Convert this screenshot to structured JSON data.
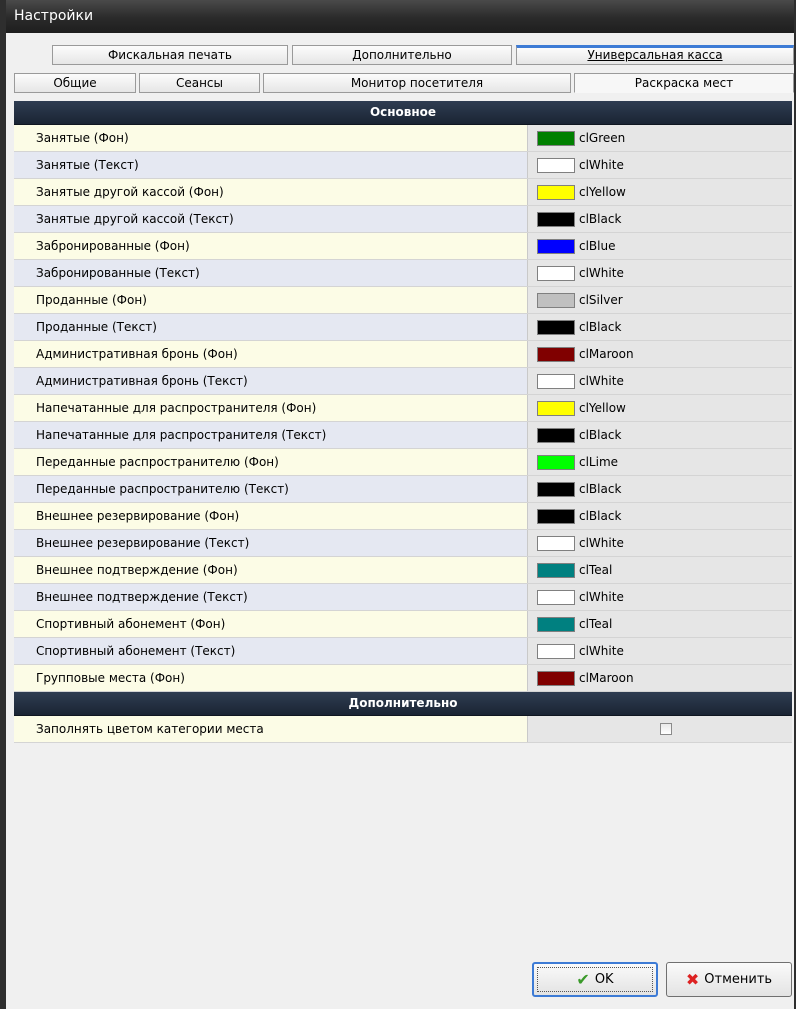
{
  "window": {
    "title": "Настройки"
  },
  "tabs_row1": [
    "Фискальная печать",
    "Дополнительно",
    "Универсальная касса"
  ],
  "tabs_row2": [
    "Общие",
    "Сеансы",
    "Монитор посетителя",
    "Раскраска мест"
  ],
  "sections": {
    "main": "Основное",
    "extra": "Дополнительно"
  },
  "rows": [
    {
      "label": "Занятые (Фон)",
      "color_name": "clGreen",
      "color": "#008000"
    },
    {
      "label": "Занятые (Текст)",
      "color_name": "clWhite",
      "color": "#ffffff"
    },
    {
      "label": "Занятые другой кассой (Фон)",
      "color_name": "clYellow",
      "color": "#ffff00"
    },
    {
      "label": "Занятые другой кассой (Текст)",
      "color_name": "clBlack",
      "color": "#000000"
    },
    {
      "label": "Забронированные (Фон)",
      "color_name": "clBlue",
      "color": "#0000ff"
    },
    {
      "label": "Забронированные (Текст)",
      "color_name": "clWhite",
      "color": "#ffffff"
    },
    {
      "label": "Проданные (Фон)",
      "color_name": "clSilver",
      "color": "#c0c0c0"
    },
    {
      "label": "Проданные (Текст)",
      "color_name": "clBlack",
      "color": "#000000"
    },
    {
      "label": "Административная бронь (Фон)",
      "color_name": "clMaroon",
      "color": "#800000"
    },
    {
      "label": "Административная бронь (Текст)",
      "color_name": "clWhite",
      "color": "#ffffff"
    },
    {
      "label": "Напечатанные для распространителя (Фон)",
      "color_name": "clYellow",
      "color": "#ffff00"
    },
    {
      "label": "Напечатанные для распространителя (Текст)",
      "color_name": "clBlack",
      "color": "#000000"
    },
    {
      "label": "Переданные распространителю (Фон)",
      "color_name": "clLime",
      "color": "#00ff00"
    },
    {
      "label": "Переданные распространителю (Текст)",
      "color_name": "clBlack",
      "color": "#000000"
    },
    {
      "label": "Внешнее резервирование (Фон)",
      "color_name": "clBlack",
      "color": "#000000"
    },
    {
      "label": "Внешнее резервирование (Текст)",
      "color_name": "clWhite",
      "color": "#ffffff"
    },
    {
      "label": "Внешнее подтверждение (Фон)",
      "color_name": "clTeal",
      "color": "#008080"
    },
    {
      "label": "Внешнее подтверждение (Текст)",
      "color_name": "clWhite",
      "color": "#ffffff"
    },
    {
      "label": "Спортивный абонемент (Фон)",
      "color_name": "clTeal",
      "color": "#008080"
    },
    {
      "label": "Спортивный абонемент (Текст)",
      "color_name": "clWhite",
      "color": "#ffffff"
    },
    {
      "label": "Групповые места (Фон)",
      "color_name": "clMaroon",
      "color": "#800000"
    }
  ],
  "extra_rows": [
    {
      "label": "Заполнять цветом категории места",
      "checked": false
    }
  ],
  "buttons": {
    "ok": "OK",
    "cancel": "Отменить"
  },
  "icons": {
    "ok": "checkmark-icon",
    "cancel": "cross-icon"
  }
}
